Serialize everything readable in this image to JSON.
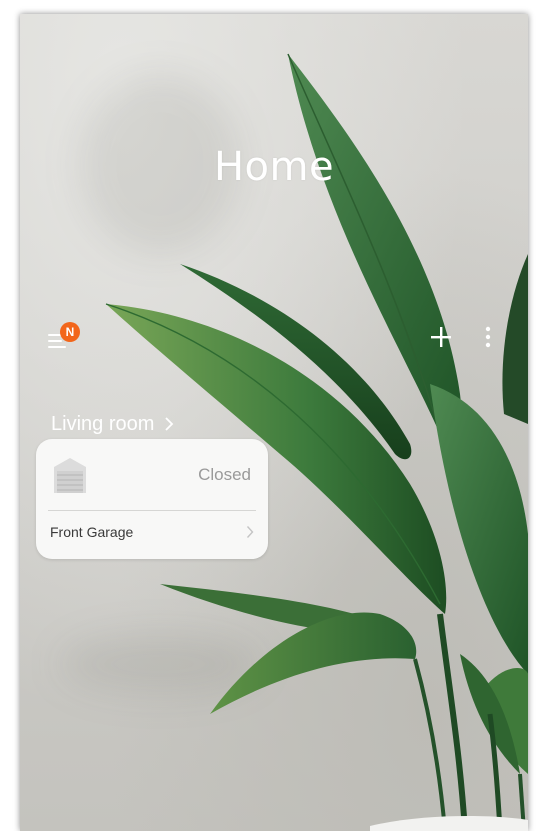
{
  "header": {
    "title": "Home"
  },
  "notifications": {
    "badge": "N"
  },
  "room": {
    "name": "Living room"
  },
  "devices": [
    {
      "name": "Front Garage",
      "status": "Closed",
      "icon": "garage-door-icon"
    }
  ],
  "colors": {
    "badge": "#f2661b",
    "card": "#f8f8f7",
    "status_text": "#9a9a9a"
  }
}
